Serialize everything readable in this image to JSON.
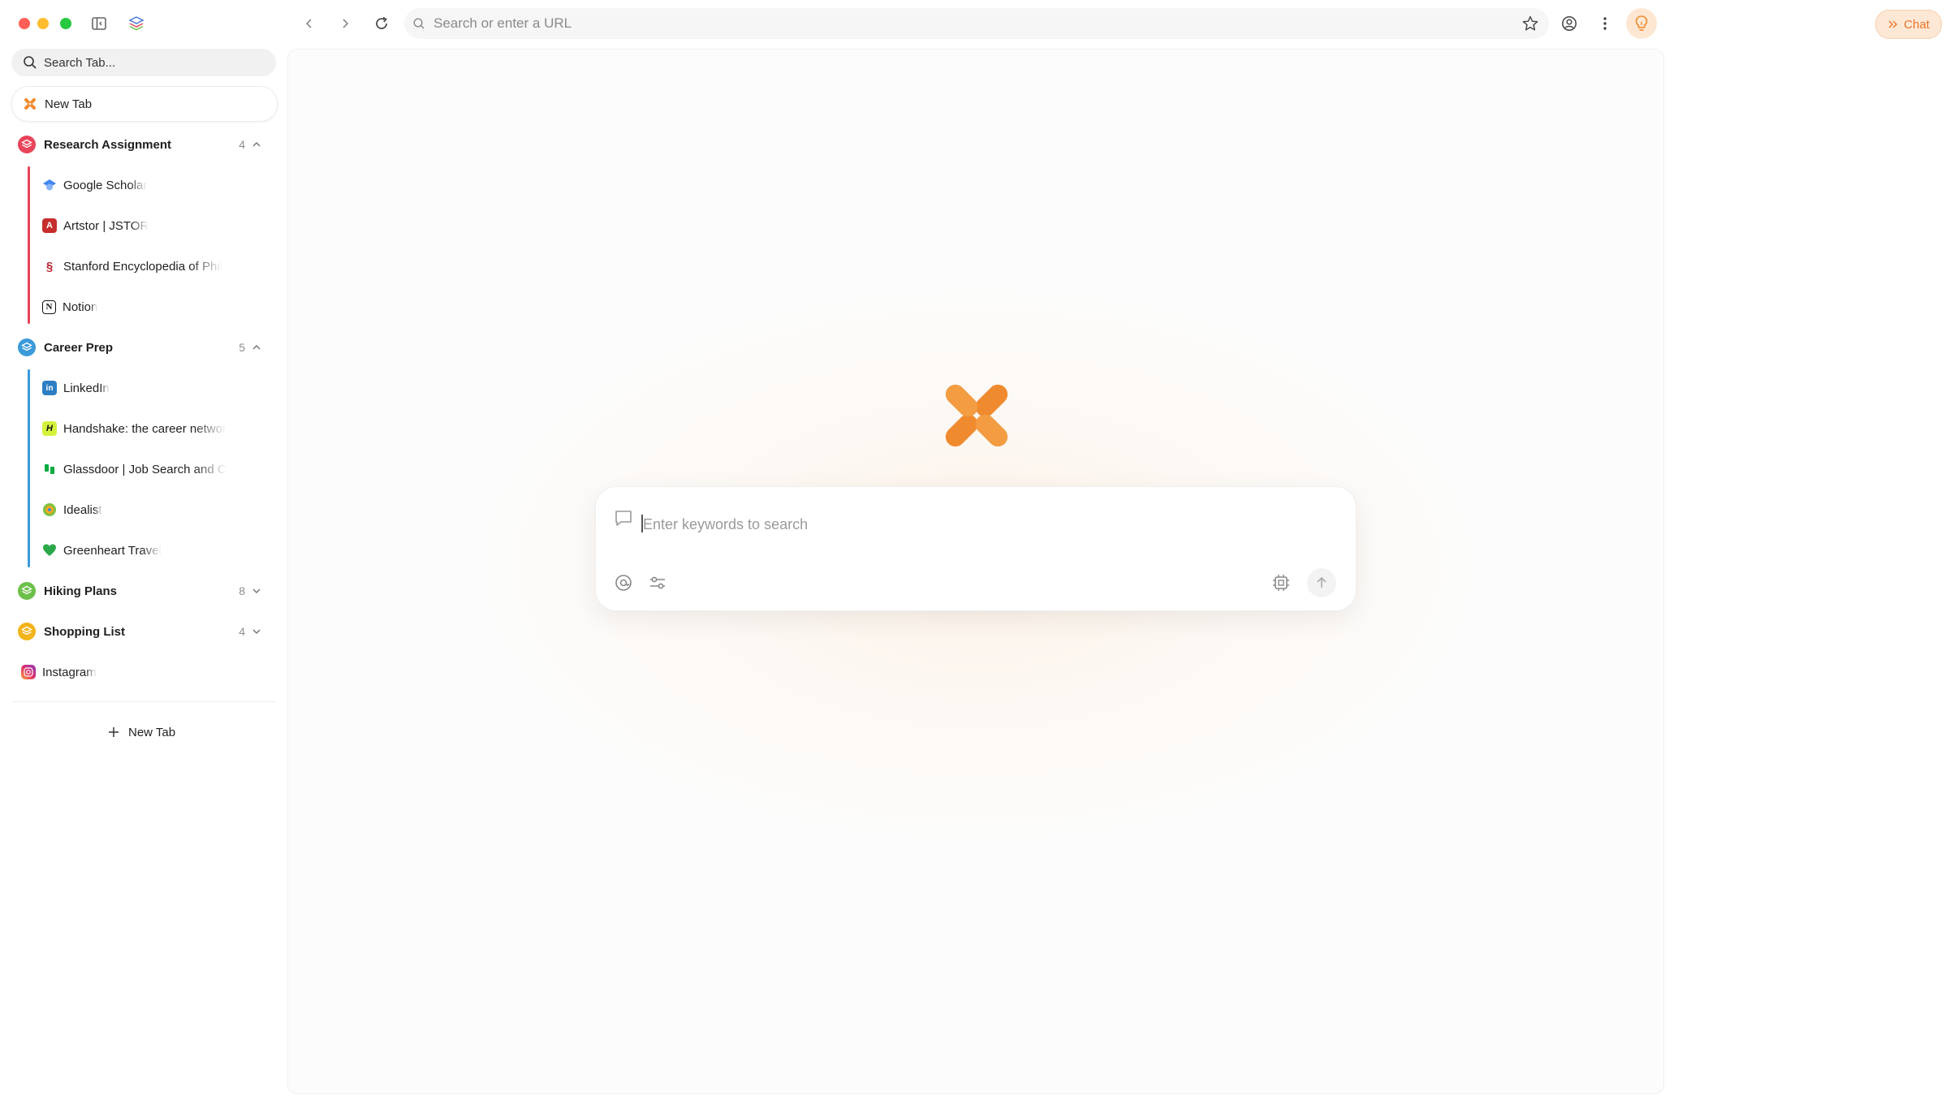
{
  "window": {
    "traffic_lights": [
      "#ff5f57",
      "#febc2e",
      "#28c840"
    ]
  },
  "sidebar": {
    "search_placeholder": "Search Tab...",
    "new_tab_top": "New Tab",
    "groups": [
      {
        "title": "Research Assignment",
        "count": "4",
        "color": "#e8445a",
        "expanded": true,
        "tabs": [
          {
            "label": "Google Scholar",
            "icon": "google-scholar-icon"
          },
          {
            "label": "Artstor | JSTOR",
            "icon": "artstor-icon"
          },
          {
            "label": "Stanford Encyclopedia of Phil",
            "icon": "stanford-icon"
          },
          {
            "label": "Notion",
            "icon": "notion-icon"
          }
        ]
      },
      {
        "title": "Career Prep",
        "count": "5",
        "color": "#3b9ad9",
        "expanded": true,
        "tabs": [
          {
            "label": "LinkedIn",
            "icon": "linkedin-icon"
          },
          {
            "label": "Handshake: the career networ",
            "icon": "handshake-icon"
          },
          {
            "label": "Glassdoor | Job Search and C",
            "icon": "glassdoor-icon"
          },
          {
            "label": "Idealist",
            "icon": "idealist-icon"
          },
          {
            "label": "Greenheart Travel",
            "icon": "heart-icon"
          }
        ]
      },
      {
        "title": "Hiking Plans",
        "count": "8",
        "color": "#6cc04a",
        "expanded": false,
        "tabs": []
      },
      {
        "title": "Shopping List",
        "count": "4",
        "color": "#f3b31b",
        "expanded": false,
        "tabs": []
      }
    ],
    "loose_tabs": [
      {
        "label": "Instagram",
        "icon": "instagram-icon"
      }
    ],
    "new_tab_bottom": "New Tab"
  },
  "toolbar": {
    "url_placeholder": "Search or enter a URL",
    "chat_label": "Chat",
    "accent": "#f08a2e"
  },
  "main": {
    "search_placeholder": "Enter keywords to search"
  }
}
